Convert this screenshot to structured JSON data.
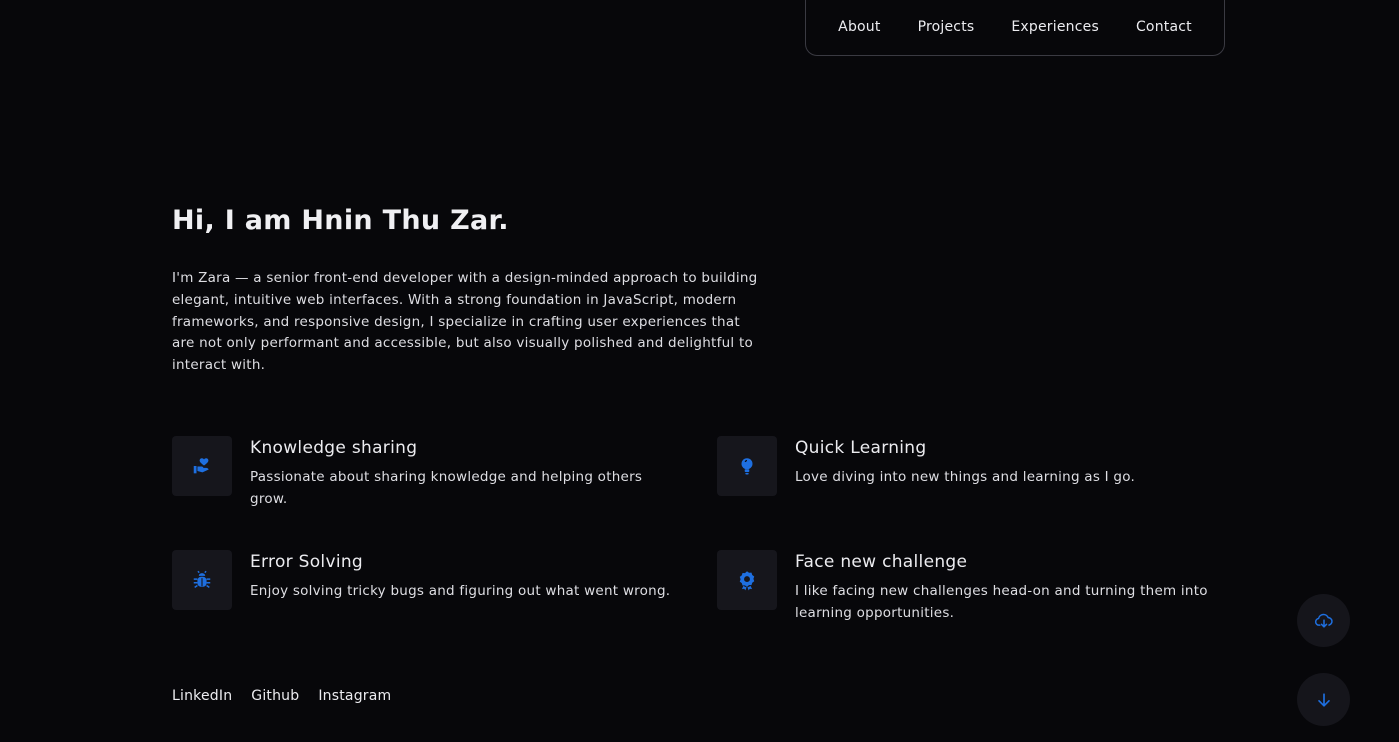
{
  "nav": {
    "items": [
      "About",
      "Projects",
      "Experiences",
      "Contact"
    ]
  },
  "hero": {
    "title": "Hi, I am Hnin Thu Zar.",
    "description": "I'm Zara — a senior front-end developer with a design-minded approach to building elegant, intuitive web interfaces. With a strong foundation in JavaScript, modern frameworks, and responsive design, I specialize in crafting user experiences that are not only performant and accessible, but also visually polished and delightful to interact with."
  },
  "features": [
    {
      "icon": "hand-heart-icon",
      "title": "Knowledge sharing",
      "description": "Passionate about sharing knowledge and helping others grow."
    },
    {
      "icon": "lightbulb-icon",
      "title": "Quick Learning",
      "description": "Love diving into new things and learning as I go."
    },
    {
      "icon": "bug-icon",
      "title": "Error Solving",
      "description": "Enjoy solving tricky bugs and figuring out what went wrong."
    },
    {
      "icon": "award-icon",
      "title": "Face new challenge",
      "description": "I like facing new challenges head-on and turning them into learning opportunities."
    }
  ],
  "social": [
    "LinkedIn",
    "Github",
    "Instagram"
  ],
  "floating_buttons": {
    "download_icon": "cloud-download-icon",
    "scroll_icon": "arrow-down-icon"
  },
  "colors": {
    "background": "#07070a",
    "accent": "#1e6fe0",
    "icon_box": "#16161c"
  }
}
